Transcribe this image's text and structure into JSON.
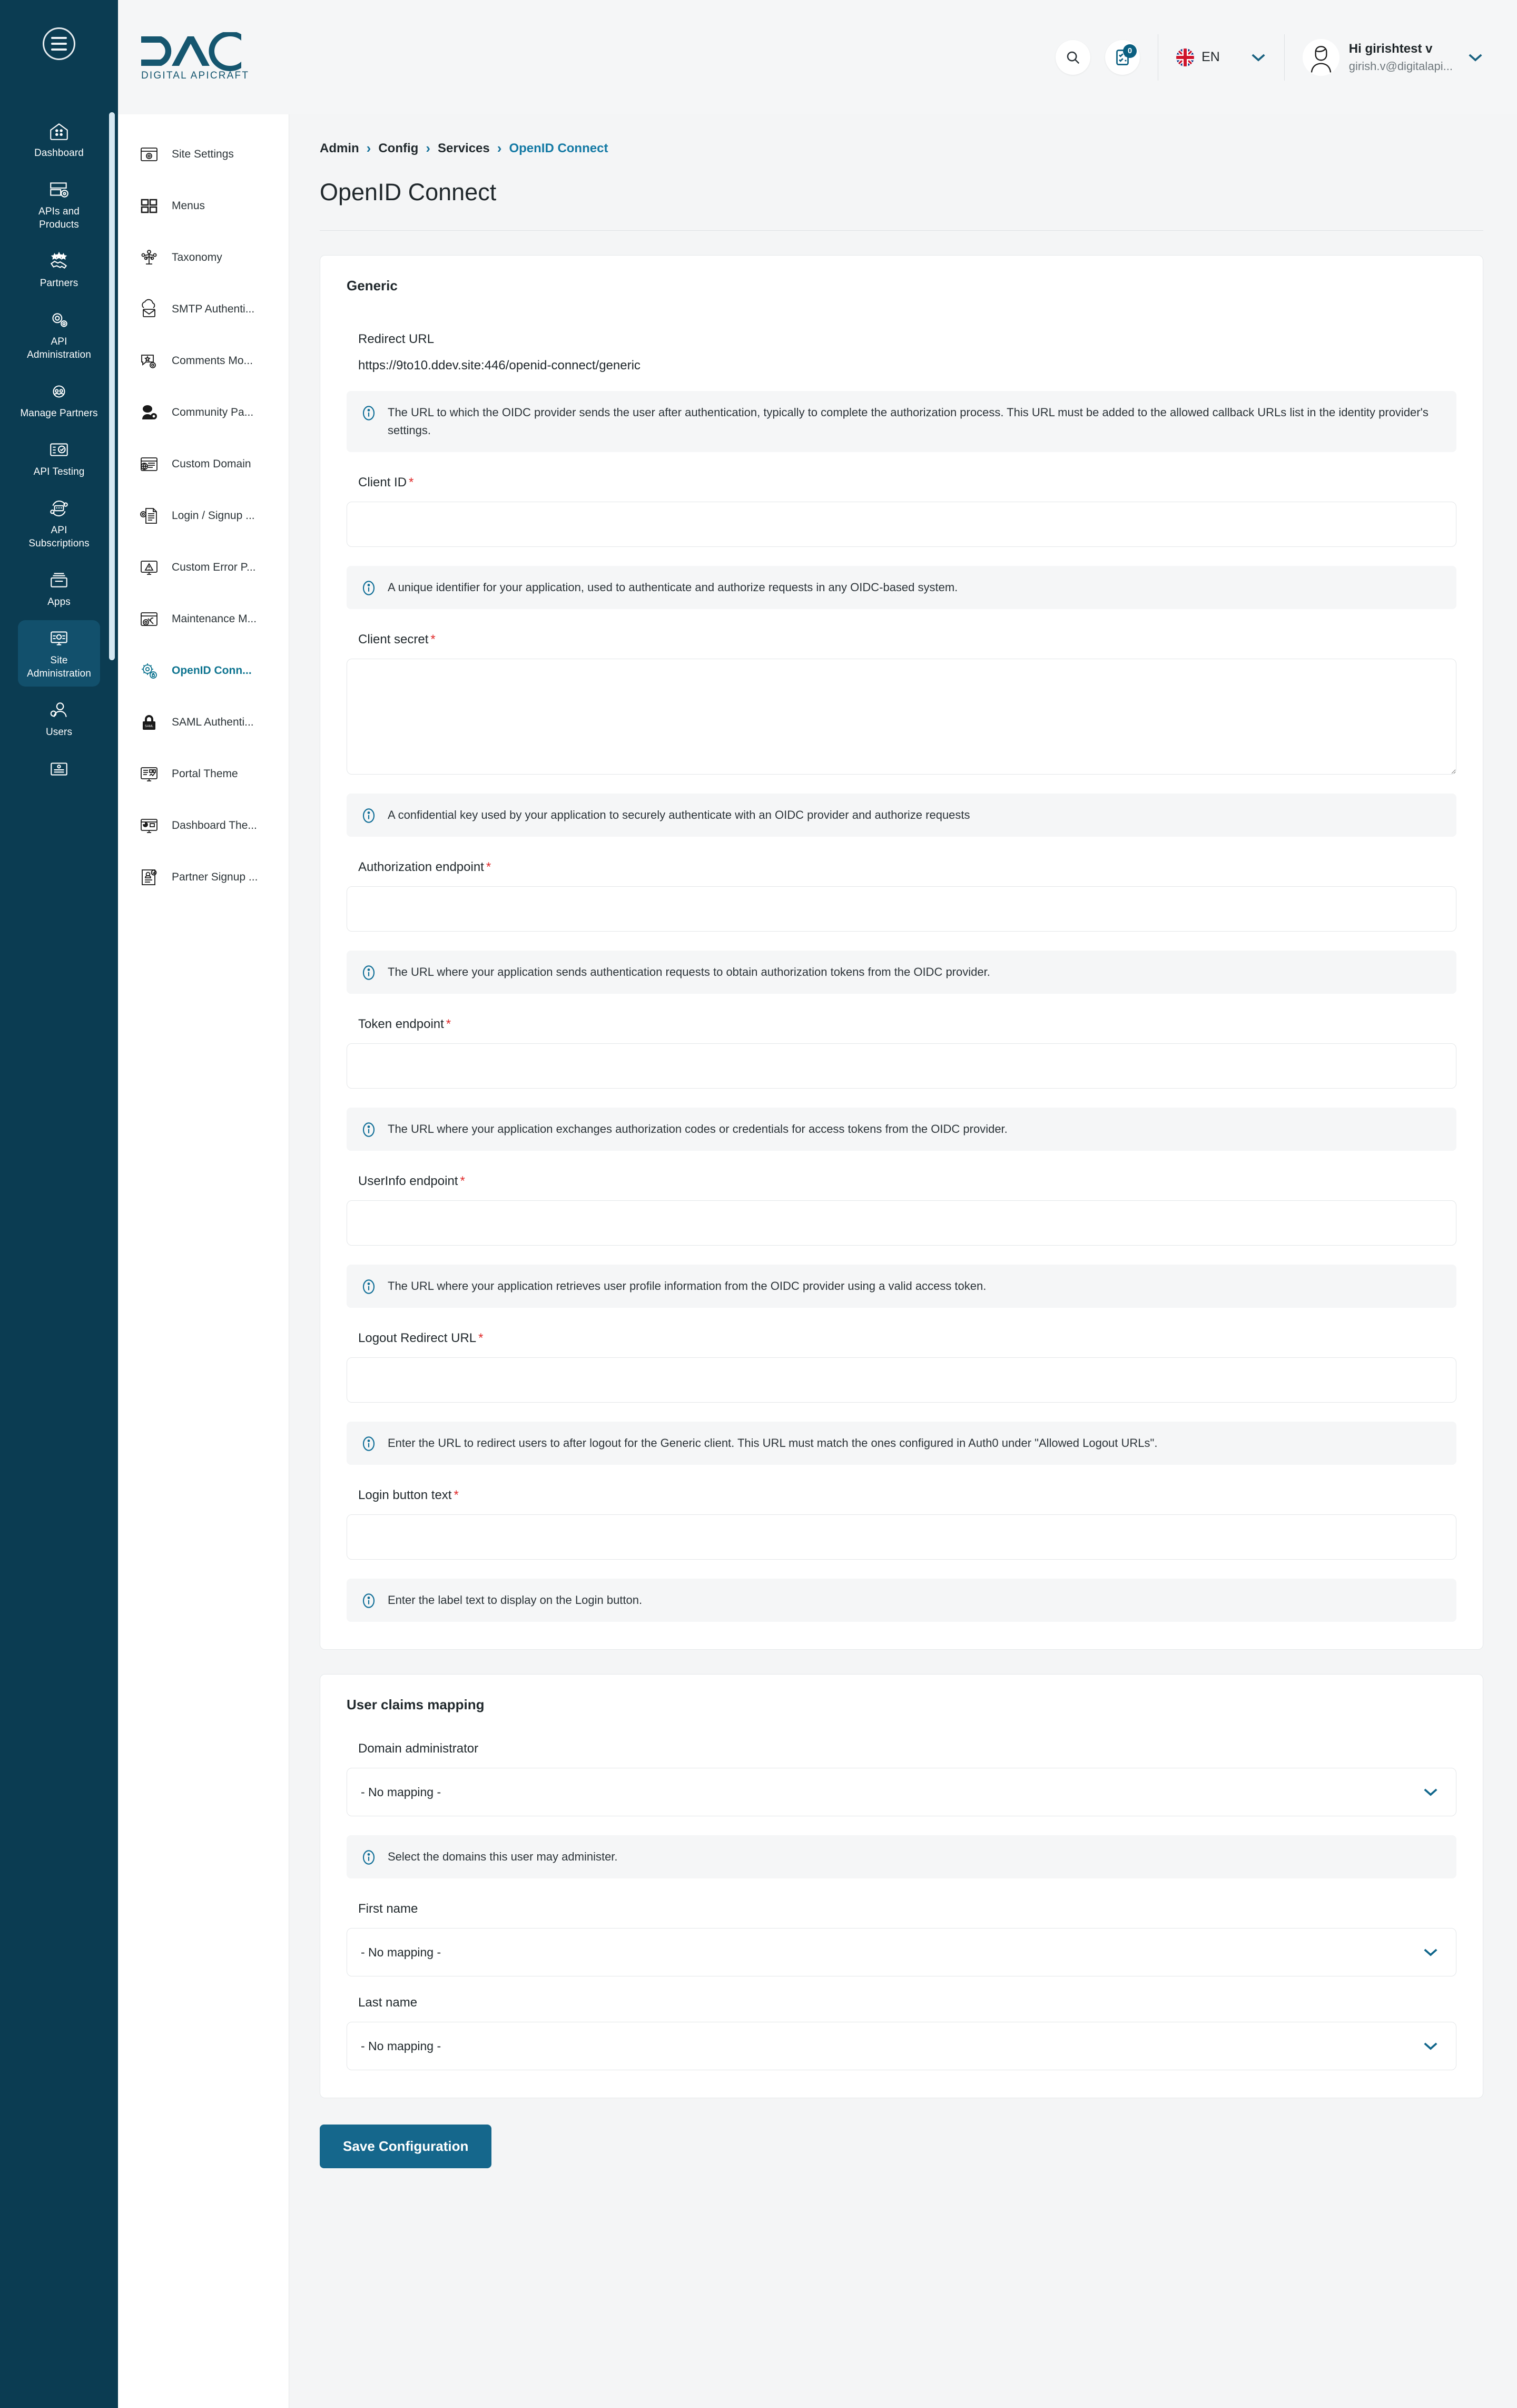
{
  "brand": {
    "name": "DAC",
    "tagline": "DIGITAL APICRAFT"
  },
  "topbar": {
    "search_icon": "search-icon",
    "notifications_icon": "tasks-icon",
    "notifications_count": "0",
    "language_code": "EN",
    "language_flag": "uk-flag-icon",
    "user_greeting": "Hi girishtest v",
    "user_email": "girish.v@digitalapi...",
    "avatar_icon": "user-avatar-icon"
  },
  "primary_nav": {
    "menu_toggle_label": "menu-toggle",
    "items": [
      {
        "label": "Dashboard",
        "icon": "dashboard-icon",
        "active": false
      },
      {
        "label": "APIs and Products",
        "icon": "apis-products-icon",
        "active": false
      },
      {
        "label": "Partners",
        "icon": "partners-icon",
        "active": false
      },
      {
        "label": "API Administration",
        "icon": "api-administration-icon",
        "active": false
      },
      {
        "label": "Manage Partners",
        "icon": "manage-partners-icon",
        "active": false
      },
      {
        "label": "API Testing",
        "icon": "api-testing-icon",
        "active": false
      },
      {
        "label": "API Subscriptions",
        "icon": "api-subscriptions-icon",
        "active": false
      },
      {
        "label": "Apps",
        "icon": "apps-icon",
        "active": false
      },
      {
        "label": "Site Administration",
        "icon": "site-administration-icon",
        "active": true
      },
      {
        "label": "Users",
        "icon": "users-icon",
        "active": false
      },
      {
        "label": "",
        "icon": "documentation-icon",
        "active": false
      }
    ]
  },
  "secondary_nav": {
    "items": [
      {
        "label": "Site Settings",
        "icon": "site-settings-icon",
        "active": false
      },
      {
        "label": "Menus",
        "icon": "menus-icon",
        "active": false
      },
      {
        "label": "Taxonomy",
        "icon": "taxonomy-icon",
        "active": false
      },
      {
        "label": "SMTP Authenti...",
        "icon": "smtp-authentication-icon",
        "active": false
      },
      {
        "label": "Comments Mo...",
        "icon": "comments-moderation-icon",
        "active": false
      },
      {
        "label": "Community Pa...",
        "icon": "community-page-icon",
        "active": false
      },
      {
        "label": "Custom Domain",
        "icon": "custom-domain-icon",
        "active": false
      },
      {
        "label": "Login / Signup ...",
        "icon": "login-signup-icon",
        "active": false
      },
      {
        "label": "Custom Error P...",
        "icon": "custom-error-page-icon",
        "active": false
      },
      {
        "label": "Maintenance M...",
        "icon": "maintenance-mode-icon",
        "active": false
      },
      {
        "label": "OpenID Conn...",
        "icon": "openid-connect-icon",
        "active": true
      },
      {
        "label": "SAML Authenti...",
        "icon": "saml-authentication-icon",
        "active": false
      },
      {
        "label": "Portal Theme",
        "icon": "portal-theme-icon",
        "active": false
      },
      {
        "label": "Dashboard The...",
        "icon": "dashboard-theme-icon",
        "active": false
      },
      {
        "label": "Partner Signup ...",
        "icon": "partner-signup-icon",
        "active": false
      }
    ]
  },
  "breadcrumb": {
    "items": [
      "Admin",
      "Config",
      "Services",
      "OpenID Connect"
    ],
    "separator": "›"
  },
  "page": {
    "title": "OpenID Connect"
  },
  "generic": {
    "section_title": "Generic",
    "redirect_url_label": "Redirect URL",
    "redirect_url_value": "https://9to10.ddev.site:446/openid-connect/generic",
    "redirect_url_hint": "The URL to which the OIDC provider sends the user after authentication, typically to complete the authorization process. This URL must be added to the allowed callback URLs list in the identity provider's settings.",
    "fields": [
      {
        "label": "Client ID",
        "required": true,
        "value": "",
        "multiline": false,
        "hint": "A unique identifier for your application, used to authenticate and authorize requests in any OIDC-based system."
      },
      {
        "label": "Client secret",
        "required": true,
        "value": "",
        "multiline": true,
        "hint": "A confidential key used by your application to securely authenticate with an OIDC provider and authorize requests"
      },
      {
        "label": "Authorization endpoint",
        "required": true,
        "value": "",
        "multiline": false,
        "hint": "The URL where your application sends authentication requests to obtain authorization tokens from the OIDC provider."
      },
      {
        "label": "Token endpoint",
        "required": true,
        "value": "",
        "multiline": false,
        "hint": "The URL where your application exchanges authorization codes or credentials for access tokens from the OIDC provider."
      },
      {
        "label": "UserInfo endpoint",
        "required": true,
        "value": "",
        "multiline": false,
        "hint": "The URL where your application retrieves user profile information from the OIDC provider using a valid access token."
      },
      {
        "label": "Logout Redirect URL",
        "required": true,
        "value": "",
        "multiline": false,
        "hint": "Enter the URL to redirect users to after logout for the Generic client. This URL must match the ones configured in Auth0 under \"Allowed Logout URLs\"."
      },
      {
        "label": "Login button text",
        "required": true,
        "value": "",
        "multiline": false,
        "hint": "Enter the label text to display on the Login button."
      }
    ]
  },
  "claims": {
    "section_title": "User claims mapping",
    "fields": [
      {
        "label": "Domain administrator",
        "value": "- No mapping -",
        "hint": "Select the domains this user may administer."
      },
      {
        "label": "First name",
        "value": "- No mapping -",
        "hint": ""
      },
      {
        "label": "Last name",
        "value": "- No mapping -",
        "hint": ""
      }
    ]
  },
  "actions": {
    "save_label": "Save Configuration"
  },
  "colors": {
    "sidebar_bg": "#0b3c52",
    "sidebar_active": "#12506c",
    "accent": "#15678c",
    "link": "#1379a4",
    "required": "#e02a2a",
    "page_bg": "#f4f5f6"
  }
}
